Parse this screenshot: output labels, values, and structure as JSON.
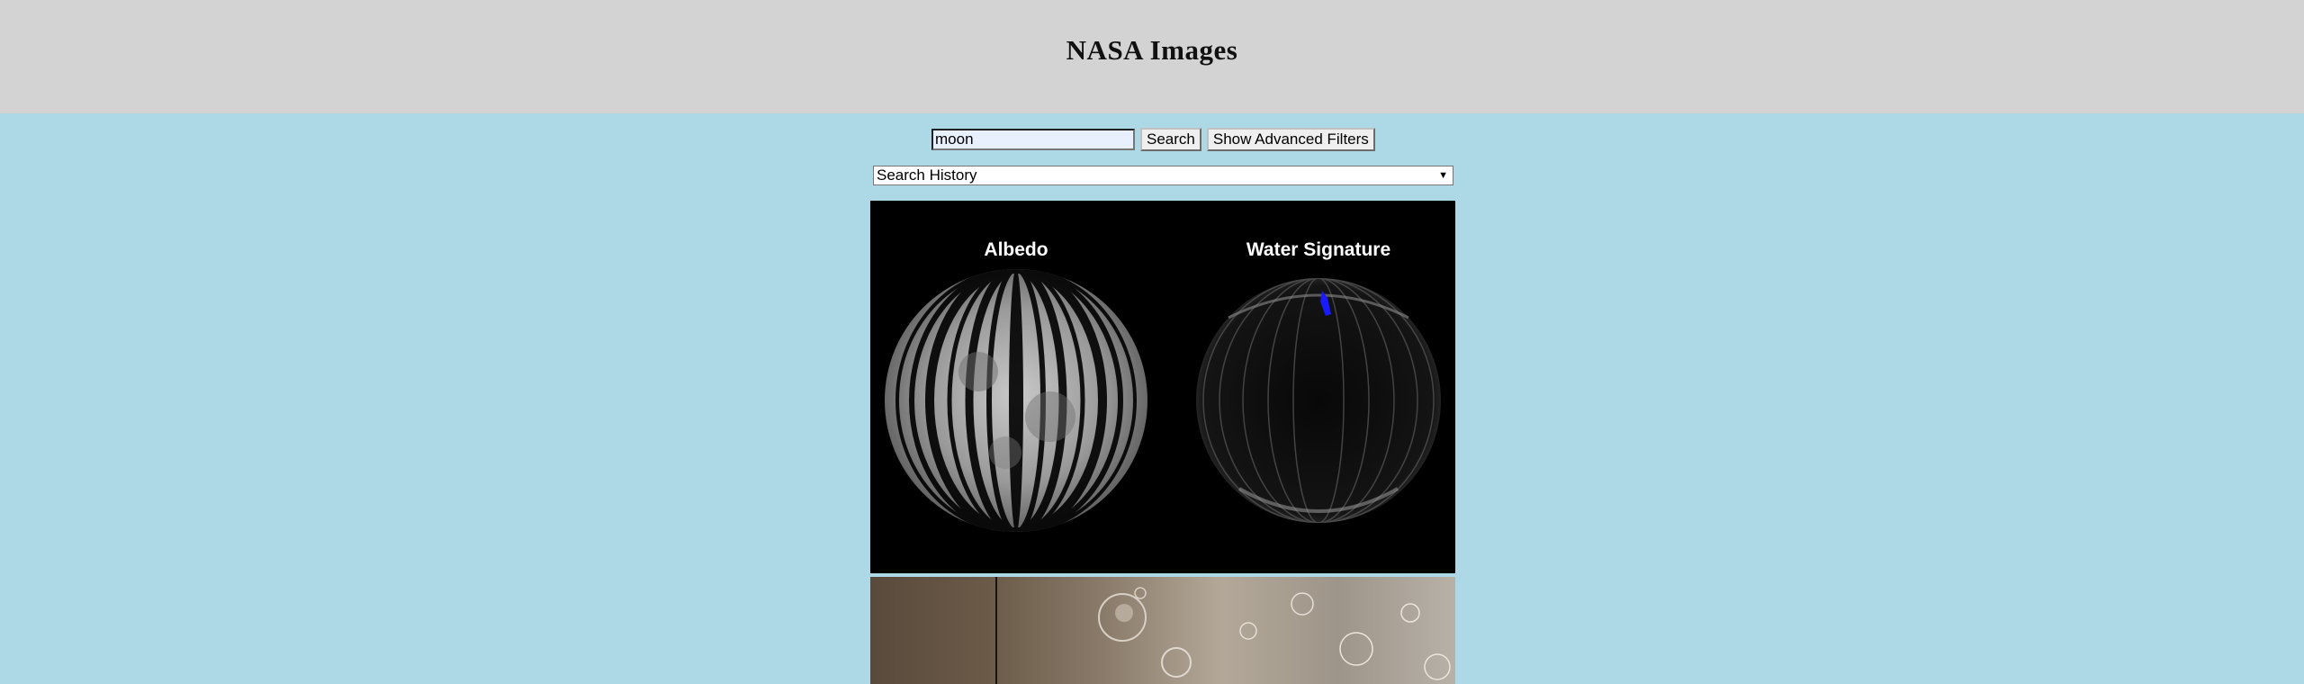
{
  "header": {
    "title": "NASA Images"
  },
  "search": {
    "query": "moon",
    "search_label": "Search",
    "advanced_label": "Show Advanced Filters"
  },
  "history": {
    "selected": "Search History"
  },
  "results": [
    {
      "left_caption": "Albedo",
      "right_caption": "Water Signature"
    }
  ]
}
